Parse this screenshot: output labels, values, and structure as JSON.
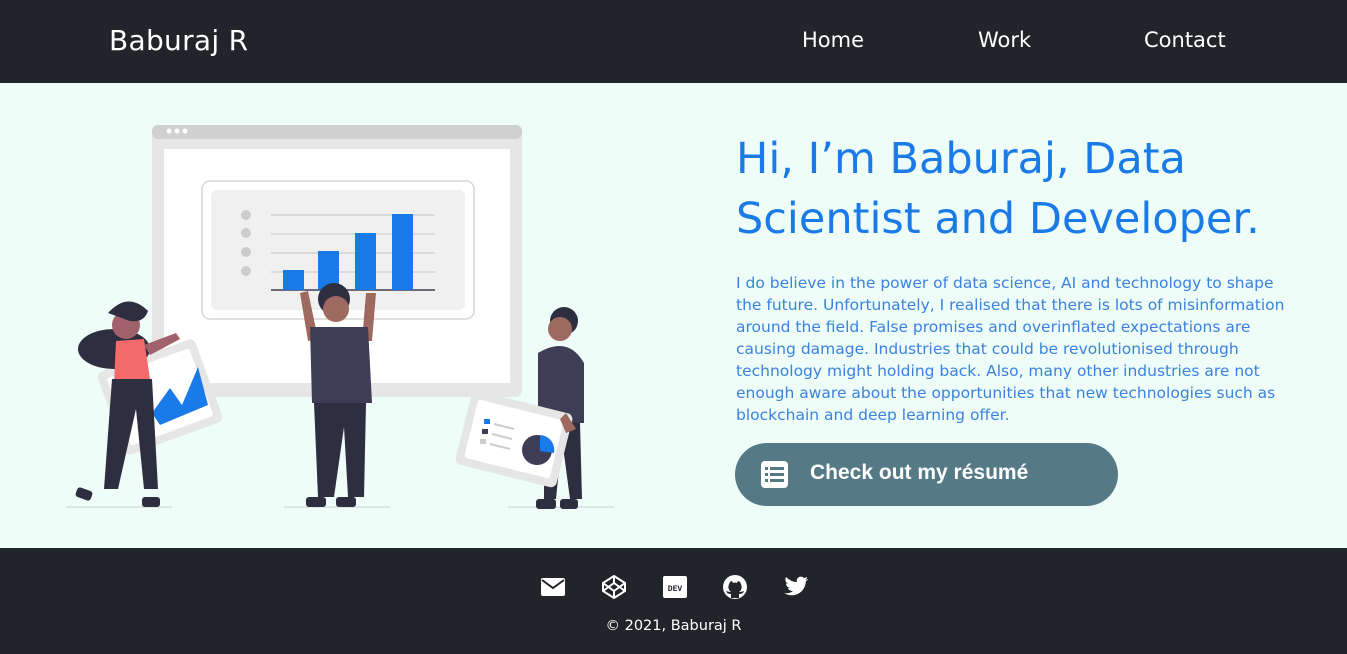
{
  "nav": {
    "brand": "Baburaj R",
    "links": [
      {
        "label": "Home"
      },
      {
        "label": "Work"
      },
      {
        "label": "Contact"
      }
    ]
  },
  "hero": {
    "headline": "Hi, I’m Baburaj, Data Scientist and Developer.",
    "intro": "I do believe in the power of data science, AI and technology to shape the future. Unfortunately, I realised that there is lots of misinformation around the field. False promises and overinflated expectations are causing damage. Industries that could be revolutionised through technology might holding back. Also, many other industries are not enough aware about the opportunities that new technologies such as blockchain and deep learning offer.",
    "resume_button": "Check out my résumé",
    "resume_icon": "document-list-icon"
  },
  "footer": {
    "social_icons": [
      "email-icon",
      "codepen-icon",
      "dev-icon",
      "github-icon",
      "twitter-icon"
    ],
    "copyright": "© 2021, Baburaj R"
  },
  "colors": {
    "nav_bg": "#212529",
    "hero_bg": "#eefdf8",
    "accent": "#1a7be8",
    "button_bg": "#557a86"
  }
}
